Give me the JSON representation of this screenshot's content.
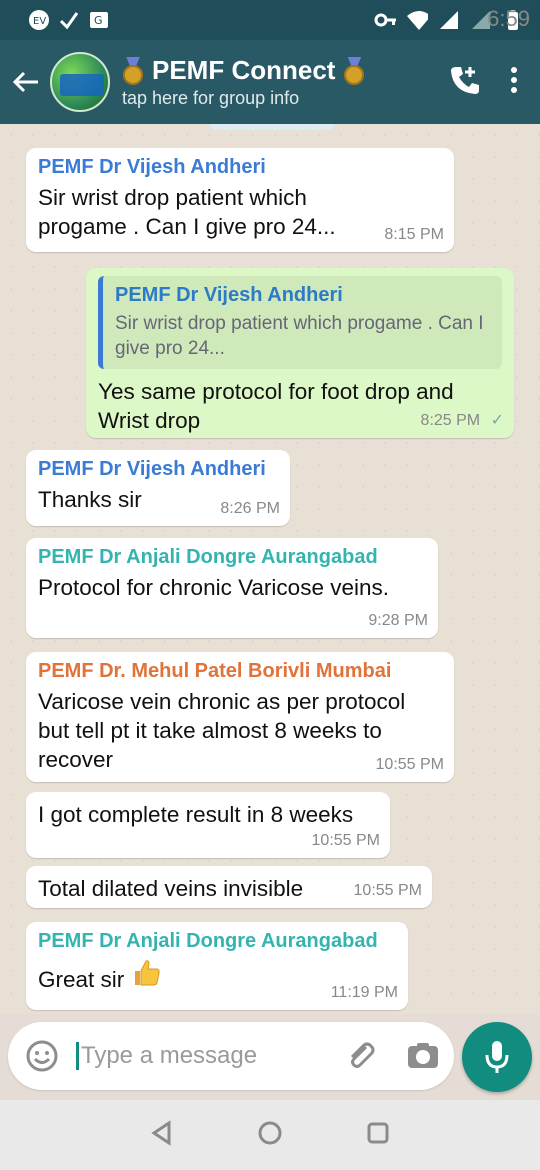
{
  "status_bar": {
    "time": "6:59",
    "icons": [
      "vpn-badge-icon",
      "check-icon",
      "translate-icon",
      "key-icon",
      "wifi-icon",
      "signal-icon",
      "battery-icon"
    ]
  },
  "header": {
    "title": "PEMF Connect",
    "subtitle": "tap here for group info",
    "icons": [
      "back-arrow-icon",
      "group-avatar",
      "medal-icon",
      "medal-icon",
      "add-call-icon",
      "more-vert-icon"
    ]
  },
  "messages": [
    {
      "sender": "PEMF Dr Vijesh Andheri",
      "sender_color": "#3a7bd5",
      "text": "Sir wrist drop patient which progame . Can I give pro 24...",
      "time": "8:15 PM"
    },
    {
      "outgoing": true,
      "quote": {
        "sender": "PEMF Dr Vijesh Andheri",
        "text": "Sir wrist drop patient which progame . Can I give pro 24..."
      },
      "text": "Yes same protocol for foot drop and Wrist drop",
      "time": "8:25 PM"
    },
    {
      "sender": "PEMF Dr Vijesh Andheri",
      "sender_color": "#3a7bd5",
      "text": "Thanks sir",
      "time": "8:26 PM"
    },
    {
      "sender": "PEMF Dr Anjali Dongre Aurangabad",
      "sender_color": "#35b3b0",
      "text": "Protocol  for chronic  Varicose veins.",
      "time": "9:28 PM"
    },
    {
      "sender": "PEMF Dr. Mehul Patel Borivli Mumbai",
      "sender_color": "#e0733a",
      "text": "Varicose vein chronic as per protocol but tell pt it take almost 8 weeks to recover",
      "time": "10:55 PM"
    },
    {
      "text": "I got complete result in 8 weeks",
      "time": "10:55 PM"
    },
    {
      "text": "Total dilated veins invisible",
      "time": "10:55 PM"
    },
    {
      "sender": "PEMF Dr Anjali Dongre Aurangabad",
      "sender_color": "#35b3b0",
      "text": "Great sir",
      "emoji": "thumbs-up-emoji",
      "time": "11:19 PM"
    }
  ],
  "composer": {
    "placeholder": "Type a message",
    "icons": [
      "emoji-icon",
      "attach-icon",
      "camera-icon",
      "mic-icon"
    ]
  },
  "nav_bar": {
    "icons": [
      "back-triangle-icon",
      "home-circle-icon",
      "recents-square-icon"
    ]
  }
}
